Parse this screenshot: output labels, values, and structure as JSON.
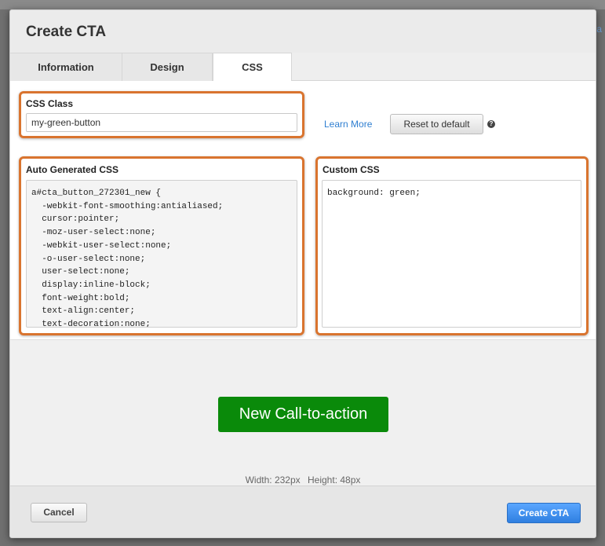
{
  "background": {
    "link_fragment": "a"
  },
  "modal": {
    "title": "Create CTA"
  },
  "tabs": [
    {
      "label": "Information",
      "active": false
    },
    {
      "label": "Design",
      "active": false
    },
    {
      "label": "CSS",
      "active": true
    }
  ],
  "css_class": {
    "label": "CSS Class",
    "value": "my-green-button"
  },
  "learn_more": {
    "label": "Learn More"
  },
  "reset_button": {
    "label": "Reset to default"
  },
  "help_icon": {
    "glyph": "?"
  },
  "auto_css": {
    "label": "Auto Generated CSS",
    "code": "a#cta_button_272301_new {\n  -webkit-font-smoothing:antialiased;\n  cursor:pointer;\n  -moz-user-select:none;\n  -webkit-user-select:none;\n  -o-user-select:none;\n  user-select:none;\n  display:inline-block;\n  font-weight:bold;\n  text-align:center;\n  text-decoration:none;"
  },
  "custom_css": {
    "label": "Custom CSS",
    "code": "background: green;"
  },
  "preview": {
    "cta_text": "New Call-to-action",
    "width_text": "Width: 232px",
    "height_text": "Height: 48px"
  },
  "footer": {
    "cancel_label": "Cancel",
    "create_label": "Create CTA"
  },
  "colors": {
    "highlight": "#d9742f",
    "cta_green": "#0a8a0a",
    "primary_blue": "#2f7fe0",
    "link_blue": "#2f7fd1"
  }
}
